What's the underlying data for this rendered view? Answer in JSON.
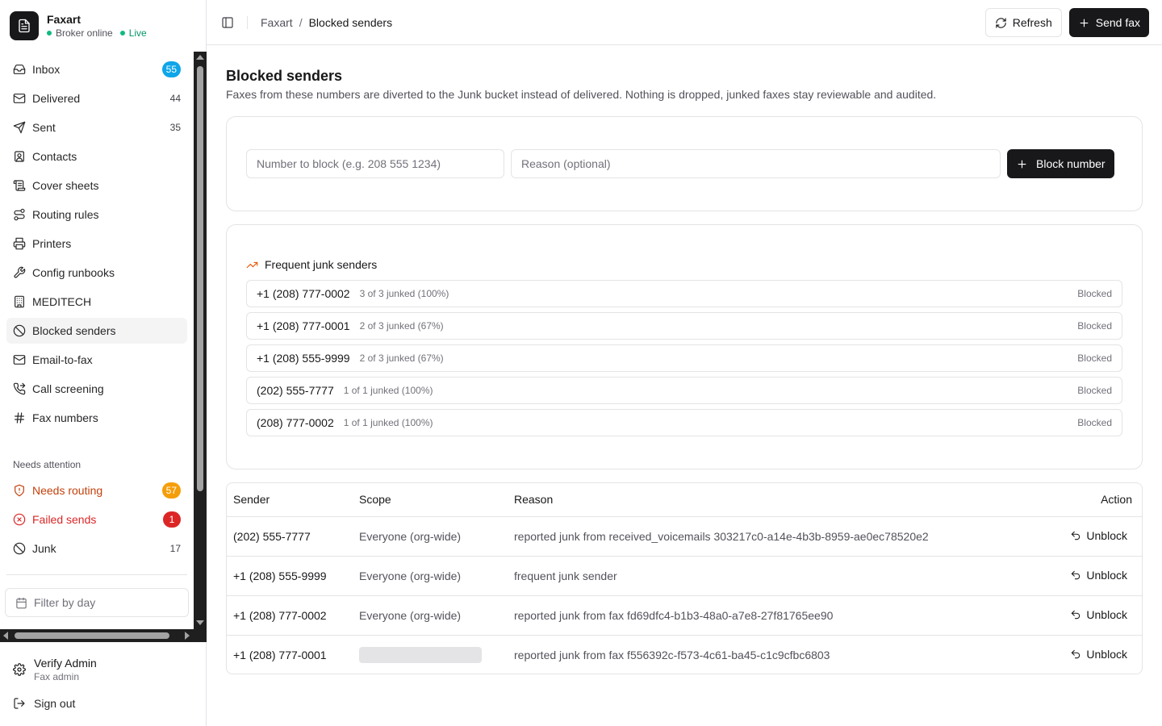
{
  "app": {
    "name": "Faxart",
    "status": "Broker online",
    "live": "Live"
  },
  "nav": [
    {
      "label": "Inbox",
      "icon": "inbox-icon",
      "count": "55",
      "pill": true,
      "pill_color": "#0ea5e9"
    },
    {
      "label": "Delivered",
      "icon": "mail-icon",
      "count": "44"
    },
    {
      "label": "Sent",
      "icon": "send-icon",
      "count": "35"
    },
    {
      "label": "Contacts",
      "icon": "contact-icon"
    },
    {
      "label": "Cover sheets",
      "icon": "scroll-icon"
    },
    {
      "label": "Routing rules",
      "icon": "route-icon"
    },
    {
      "label": "Printers",
      "icon": "printer-icon"
    },
    {
      "label": "Config runbooks",
      "icon": "wrench-icon"
    },
    {
      "label": "MEDITECH",
      "icon": "building-icon"
    },
    {
      "label": "Blocked senders",
      "icon": "ban-icon",
      "active": true
    },
    {
      "label": "Email-to-fax",
      "icon": "mail-icon"
    },
    {
      "label": "Call screening",
      "icon": "phone-forward-icon"
    },
    {
      "label": "Fax numbers",
      "icon": "hash-icon"
    }
  ],
  "attention": {
    "label": "Needs attention",
    "items": [
      {
        "label": "Needs routing",
        "icon": "shield-alert-icon",
        "count": "57",
        "pill": true,
        "pill_color": "#f59e0b",
        "color": "#c2410c"
      },
      {
        "label": "Failed sends",
        "icon": "x-circle-icon",
        "count": "1",
        "pill": true,
        "pill_color": "#dc2626",
        "color": "#dc2626"
      },
      {
        "label": "Junk",
        "icon": "ban-icon",
        "count": "17"
      }
    ]
  },
  "filter": {
    "placeholder": "Filter by day"
  },
  "user": {
    "name": "Verify Admin",
    "role": "Fax admin",
    "signout": "Sign out"
  },
  "header": {
    "crumb_root": "Faxart",
    "crumb_sep": "/",
    "crumb_current": "Blocked senders",
    "refresh": "Refresh",
    "send_fax": "Send fax"
  },
  "page": {
    "title": "Blocked senders",
    "description": "Faxes from these numbers are diverted to the Junk bucket instead of delivered. Nothing is dropped, junked faxes stay reviewable and audited."
  },
  "block_form": {
    "number_placeholder": "Number to block (e.g. 208 555 1234)",
    "reason_placeholder": "Reason (optional)",
    "button": "Block number"
  },
  "frequent": {
    "title": "Frequent junk senders",
    "rows": [
      {
        "number": "+1 (208) 777-0002",
        "stat": "3 of 3 junked (100%)",
        "status": "Blocked"
      },
      {
        "number": "+1 (208) 777-0001",
        "stat": "2 of 3 junked (67%)",
        "status": "Blocked"
      },
      {
        "number": "+1 (208) 555-9999",
        "stat": "2 of 3 junked (67%)",
        "status": "Blocked"
      },
      {
        "number": "(202) 555-7777",
        "stat": "1 of 1 junked (100%)",
        "status": "Blocked"
      },
      {
        "number": "(208) 777-0002",
        "stat": "1 of 1 junked (100%)",
        "status": "Blocked"
      }
    ]
  },
  "table": {
    "headers": {
      "sender": "Sender",
      "scope": "Scope",
      "reason": "Reason",
      "action": "Action"
    },
    "rows": [
      {
        "sender": "(202) 555-7777",
        "scope": "Everyone (org-wide)",
        "reason": "reported junk from received_voicemails 303217c0-a14e-4b3b-8959-ae0ec78520e2",
        "action": "Unblock"
      },
      {
        "sender": "+1 (208) 555-9999",
        "scope": "Everyone (org-wide)",
        "reason": "frequent junk sender",
        "action": "Unblock"
      },
      {
        "sender": "+1 (208) 777-0002",
        "scope": "Everyone (org-wide)",
        "reason": "reported junk from fax fd69dfc4-b1b3-48a0-a7e8-27f81765ee90",
        "action": "Unblock"
      },
      {
        "sender": "+1 (208) 777-0001",
        "scope": "",
        "scope_loading": true,
        "reason": "reported junk from fax f556392c-f573-4c61-ba45-c1c9cfbc6803",
        "action": "Unblock"
      }
    ]
  }
}
